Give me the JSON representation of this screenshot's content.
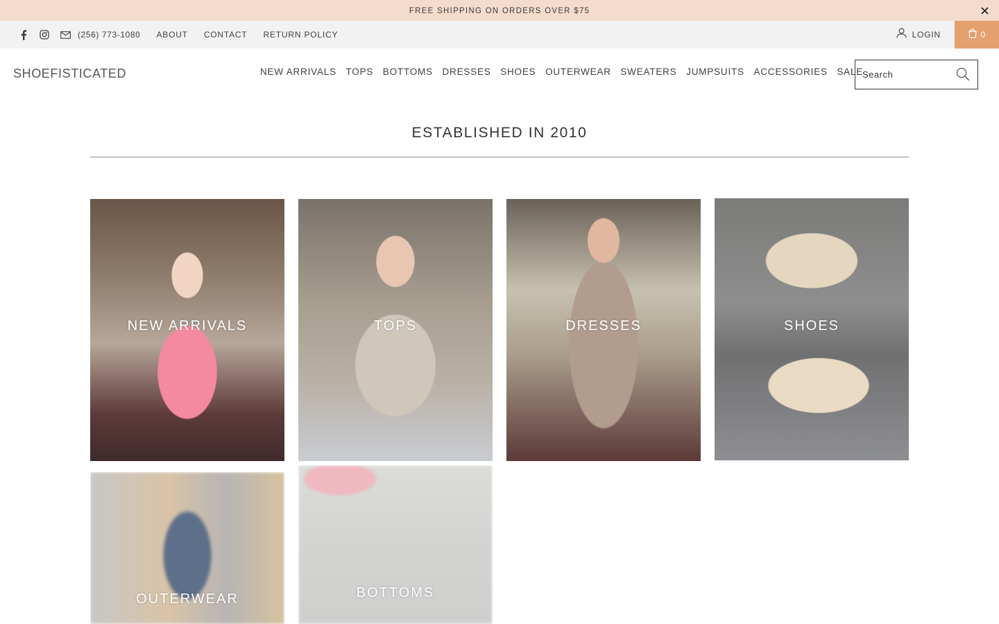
{
  "announcement": {
    "text": "FREE SHIPPING ON ORDERS OVER $75",
    "close_icon": "close-icon"
  },
  "utility": {
    "social_icons": [
      "facebook-icon",
      "instagram-icon",
      "email-icon"
    ],
    "phone": "(256) 773-1080",
    "links": [
      "ABOUT",
      "CONTACT",
      "RETURN POLICY"
    ],
    "login_label": "LOGIN",
    "cart_count": "0",
    "cart_color": "#e4a06f"
  },
  "header": {
    "logo": "SHOEFISTICATED",
    "nav": [
      "NEW ARRIVALS",
      "TOPS",
      "BOTTOMS",
      "DRESSES",
      "SHOES",
      "OUTERWEAR",
      "SWEATERS",
      "JUMPSUITS",
      "ACCESSORIES",
      "SALE"
    ],
    "search_placeholder": "Search"
  },
  "main": {
    "heading": "ESTABLISHED IN 2010",
    "collections": [
      "NEW ARRIVALS",
      "TOPS",
      "DRESSES",
      "SHOES",
      "OUTERWEAR",
      "BOTTOMS"
    ]
  },
  "colors": {
    "announcement_bg": "#f5dbcc",
    "utility_bg": "#f2f2f2",
    "accent": "#e4a06f"
  }
}
